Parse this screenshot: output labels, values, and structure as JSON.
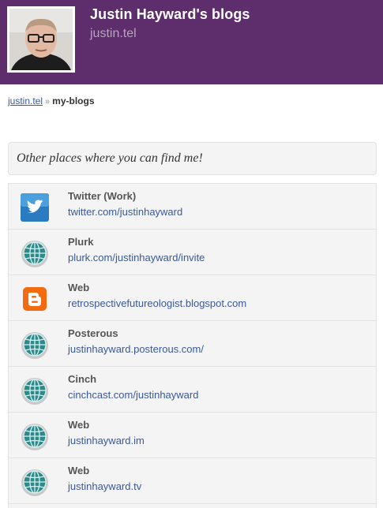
{
  "header": {
    "title": "Justin Hayward's blogs",
    "subtitle": "justin.tel",
    "colors": {
      "background": "#5e2d6b",
      "title": "#ffffff",
      "subtitle": "#b8a3c0"
    }
  },
  "breadcrumb": {
    "home": "justin.tel",
    "separator": "»",
    "current": "my-blogs"
  },
  "intro": {
    "text": "Other places where you can find me!"
  },
  "links": [
    {
      "name": "Twitter (Work)",
      "url": "twitter.com/justinhayward",
      "icon": "twitter-icon"
    },
    {
      "name": "Plurk",
      "url": "plurk.com/justinhayward/invite",
      "icon": "globe-icon"
    },
    {
      "name": "Web",
      "url": "retrospectivefutureologist.blogspot.com",
      "icon": "blogger-icon"
    },
    {
      "name": "Posterous",
      "url": "justinhayward.posterous.com/",
      "icon": "globe-icon"
    },
    {
      "name": "Cinch",
      "url": "cinchcast.com/justinhayward",
      "icon": "globe-icon"
    },
    {
      "name": "Web",
      "url": "justinhayward.im",
      "icon": "globe-icon"
    },
    {
      "name": "Web",
      "url": "justinhayward.tv",
      "icon": "globe-icon"
    }
  ],
  "colors": {
    "link": "#3b5998",
    "panel": "#f4f4f4",
    "border": "#e2e2e2"
  }
}
